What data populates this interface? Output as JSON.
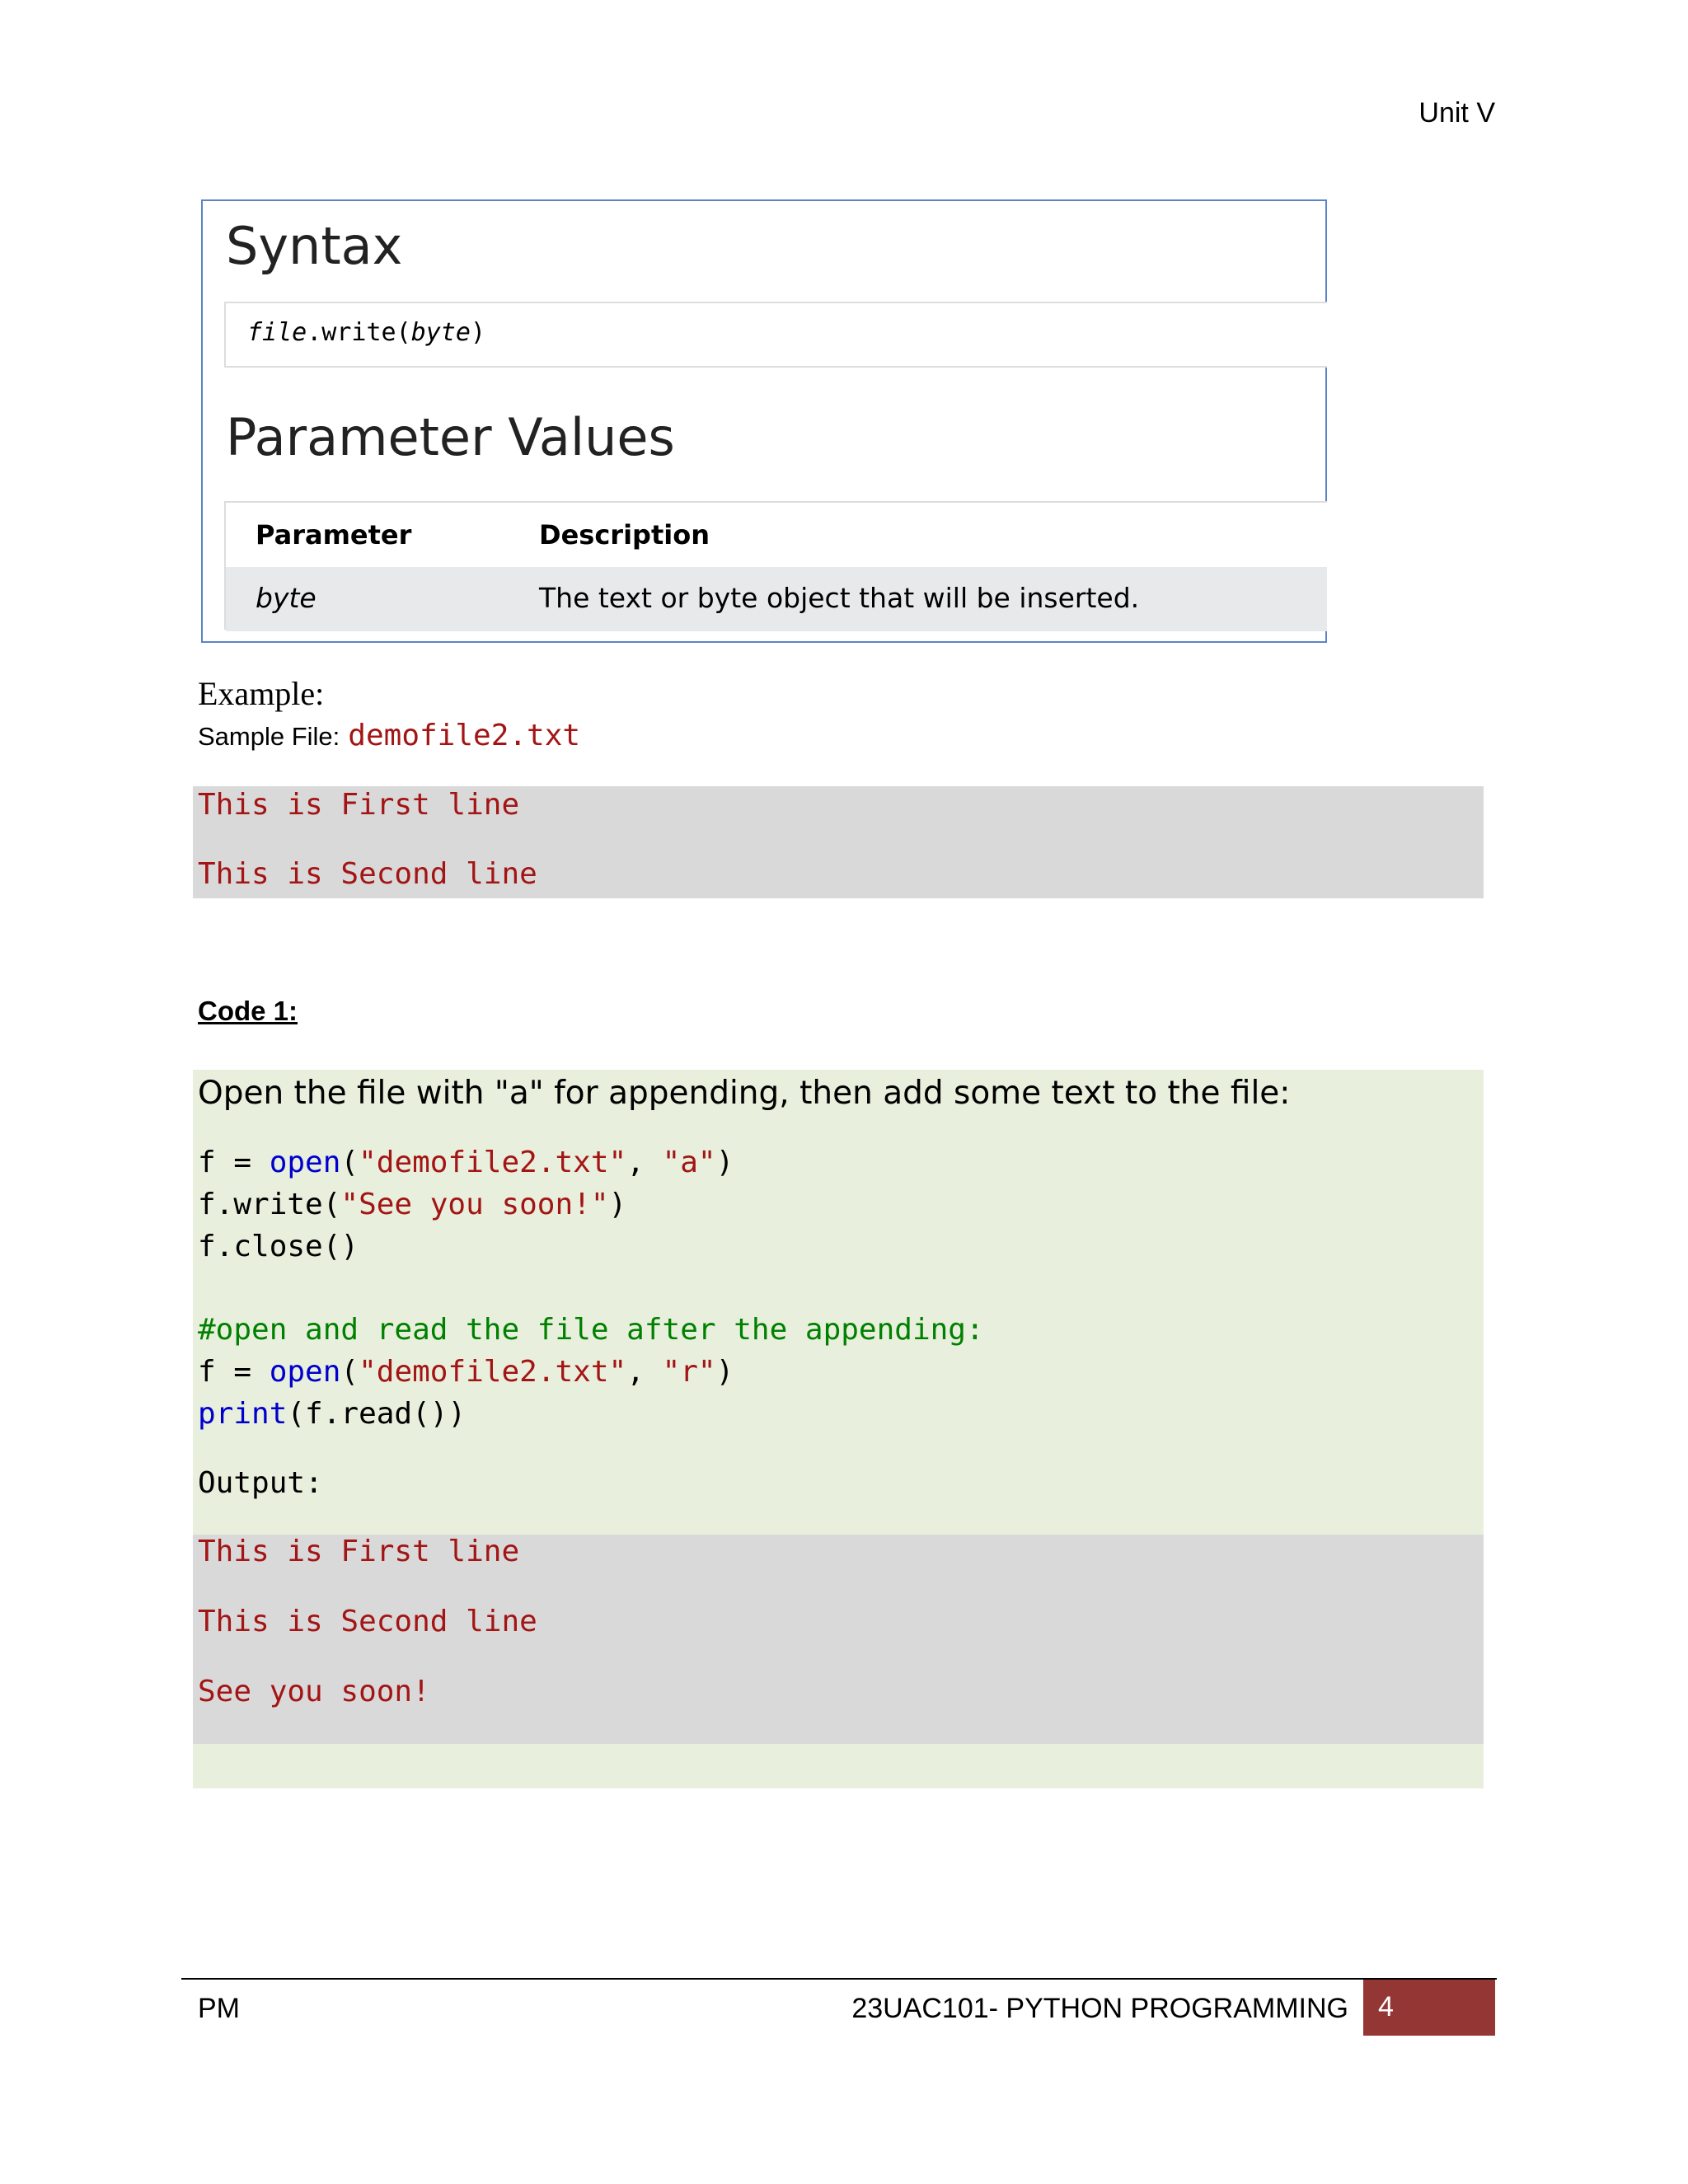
{
  "header": {
    "unit": "Unit V"
  },
  "syntax": {
    "title": "Syntax",
    "code": {
      "object": "file",
      "method": ".write(",
      "param": "byte",
      "close": ")"
    },
    "params_title": "Parameter Values",
    "table": {
      "headers": [
        "Parameter",
        "Description"
      ],
      "rows": [
        {
          "param": "byte",
          "description": "The text or byte object that will be inserted."
        }
      ]
    }
  },
  "example": {
    "label": "Example:",
    "sample_file_label": "Sample File:",
    "sample_file_name": "demofile2.txt",
    "sample_lines": [
      "This is First line",
      "This is Second line"
    ]
  },
  "code1": {
    "label": "Code 1:",
    "intro": "Open the file with \"a\" for appending, then add some text to the file:",
    "line1": {
      "a": "f = ",
      "b": "open",
      "c": "(",
      "d": "\"demofile2.txt\"",
      "e": ", ",
      "f": "\"a\"",
      "g": ")"
    },
    "line2": {
      "a": "f.write(",
      "b": "\"See you soon!\"",
      "c": ")"
    },
    "line3": "f.close()",
    "comment": "#open and read the file after the appending:",
    "line5": {
      "a": "f = ",
      "b": "open",
      "c": "(",
      "d": "\"demofile2.txt\"",
      "e": ", ",
      "f": "\"r\"",
      "g": ")"
    },
    "line6": {
      "a": "print",
      "b": "(f.read())"
    },
    "output_label": "Output:",
    "output_lines": [
      "This is First line",
      "This is Second line",
      "See you soon!"
    ]
  },
  "footer": {
    "left": "PM",
    "course": "23UAC101- PYTHON PROGRAMMING",
    "page_number": "4"
  },
  "colors": {
    "string_red": "#a31515",
    "keyword_blue": "#0000cd",
    "comment_green": "#008000",
    "code_bg": "#e8efdc",
    "output_bg": "#d9d9d9",
    "page_box": "#943634"
  }
}
